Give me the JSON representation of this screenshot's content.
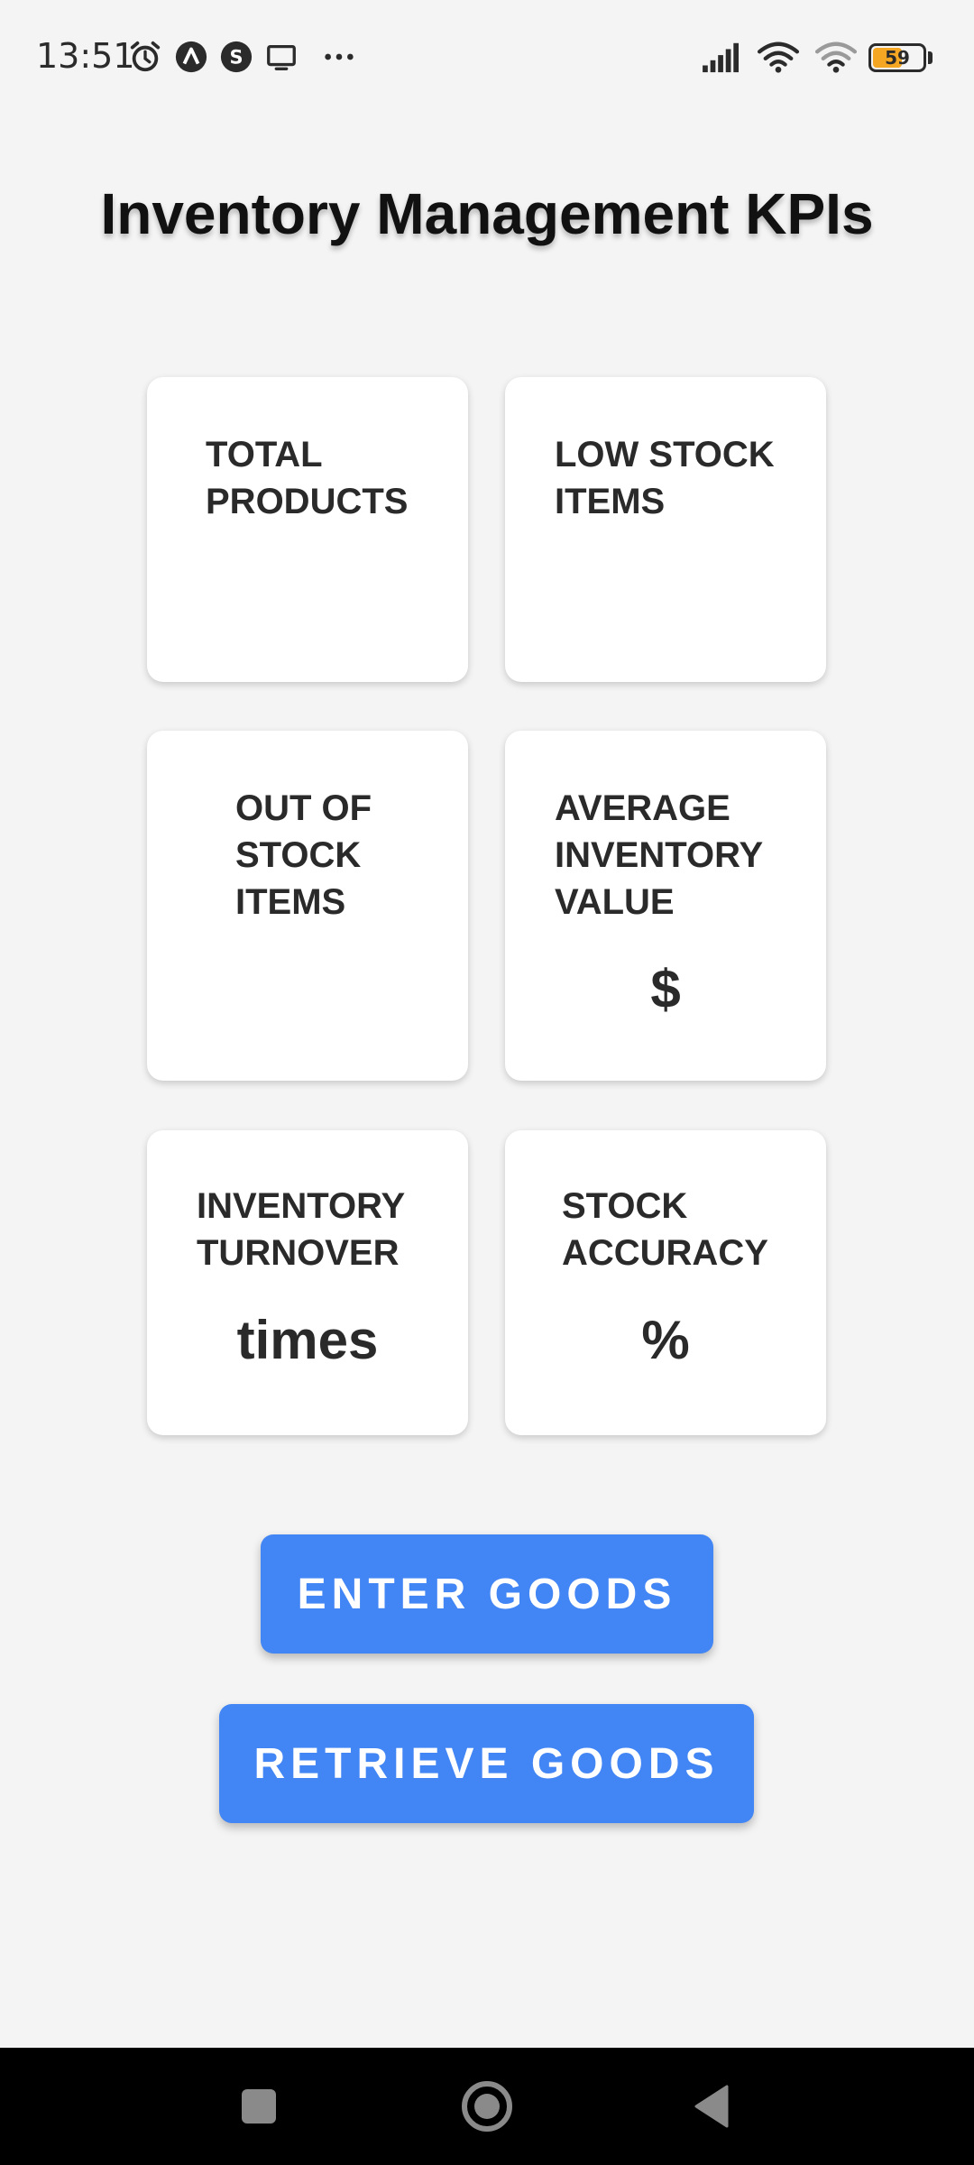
{
  "status_bar": {
    "time": "13:51",
    "battery_level": "59",
    "battery_fraction": 0.59,
    "left_icons": [
      "alarm-icon",
      "app-a-icon",
      "app-s-icon",
      "screen-cast-icon",
      "more-dots-icon"
    ],
    "right_icons": [
      "signal-icon",
      "wifi-icon",
      "wifi-icon",
      "battery-icon"
    ]
  },
  "page": {
    "title": "Inventory Management KPIs"
  },
  "kpis": [
    {
      "label": "TOTAL\nPRODUCTS",
      "value": ""
    },
    {
      "label": "LOW STOCK\nITEMS",
      "value": ""
    },
    {
      "label": "OUT OF\nSTOCK\nITEMS",
      "value": ""
    },
    {
      "label": "AVERAGE\nINVENTORY\nVALUE",
      "value": "$"
    },
    {
      "label": "INVENTORY\nTURNOVER",
      "value": "times"
    },
    {
      "label": "STOCK\nACCURACY",
      "value": "%"
    }
  ],
  "actions": {
    "enter_goods": "ENTER GOODS",
    "retrieve_goods": "RETRIEVE GOODS"
  },
  "colors": {
    "accent": "#4285f4",
    "background": "#f4f4f4",
    "card": "#ffffff",
    "battery": "#f5a623"
  },
  "nav": {
    "icons": [
      "recent-apps-icon",
      "home-icon",
      "back-icon"
    ]
  }
}
